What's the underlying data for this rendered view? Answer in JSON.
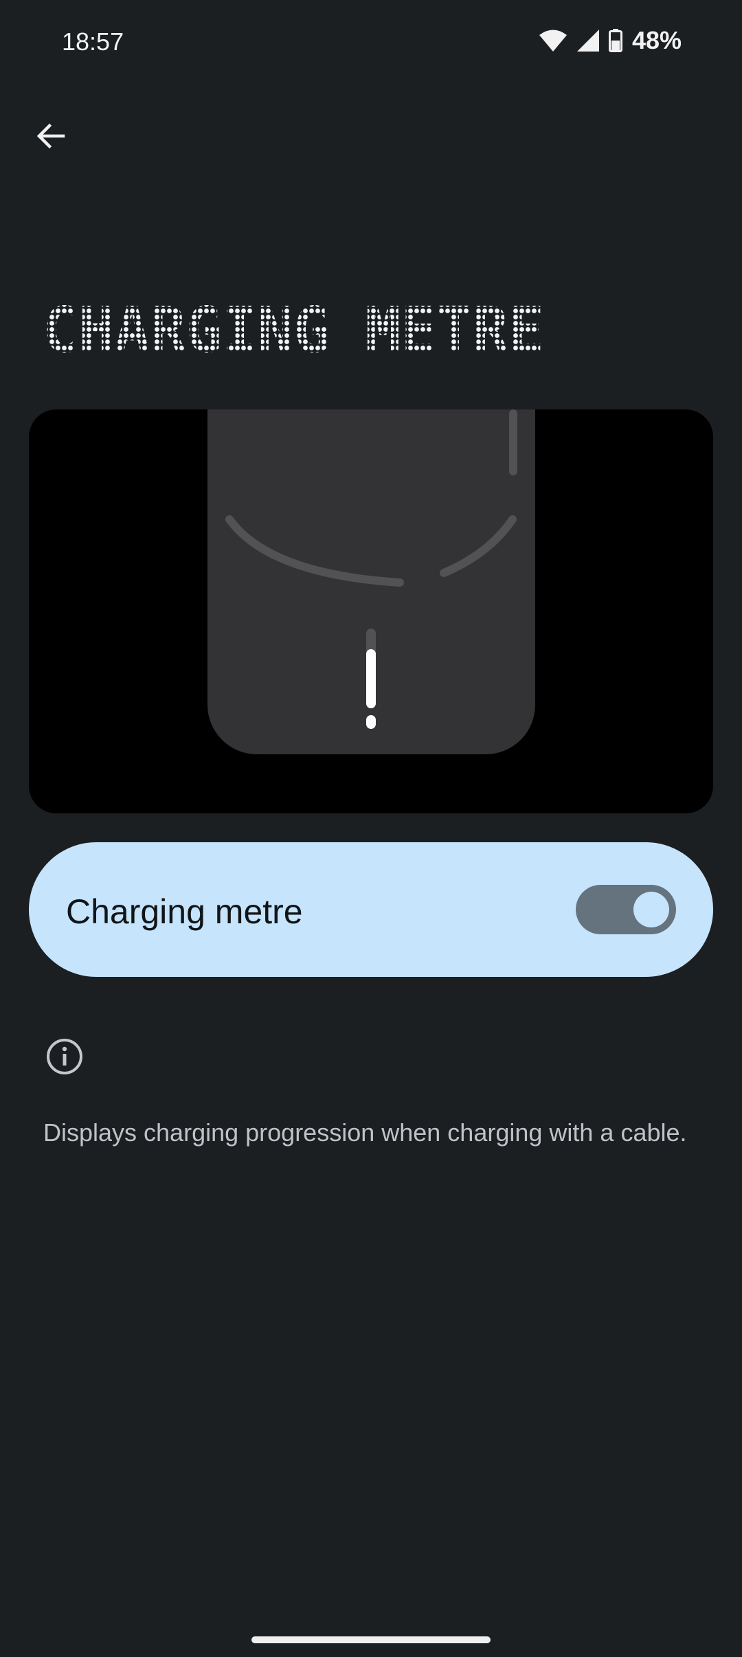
{
  "status_bar": {
    "time": "18:57",
    "battery_percent": "48%",
    "icons": [
      "wifi-icon",
      "cell-signal-icon",
      "battery-icon"
    ]
  },
  "nav": {
    "back_icon": "arrow-left-icon"
  },
  "page": {
    "title": "CHARGING METRE"
  },
  "preview": {
    "description_icon": "phone-back-glyph-preview"
  },
  "setting": {
    "label": "Charging metre",
    "enabled": true
  },
  "info": {
    "icon": "info-icon",
    "text": "Displays charging progression when charging with a cable."
  },
  "colors": {
    "background": "#1c1f22",
    "card": "#c6e4fc",
    "switch_track": "#65737f",
    "preview_bg": "#000000",
    "phone_body": "#333335"
  }
}
